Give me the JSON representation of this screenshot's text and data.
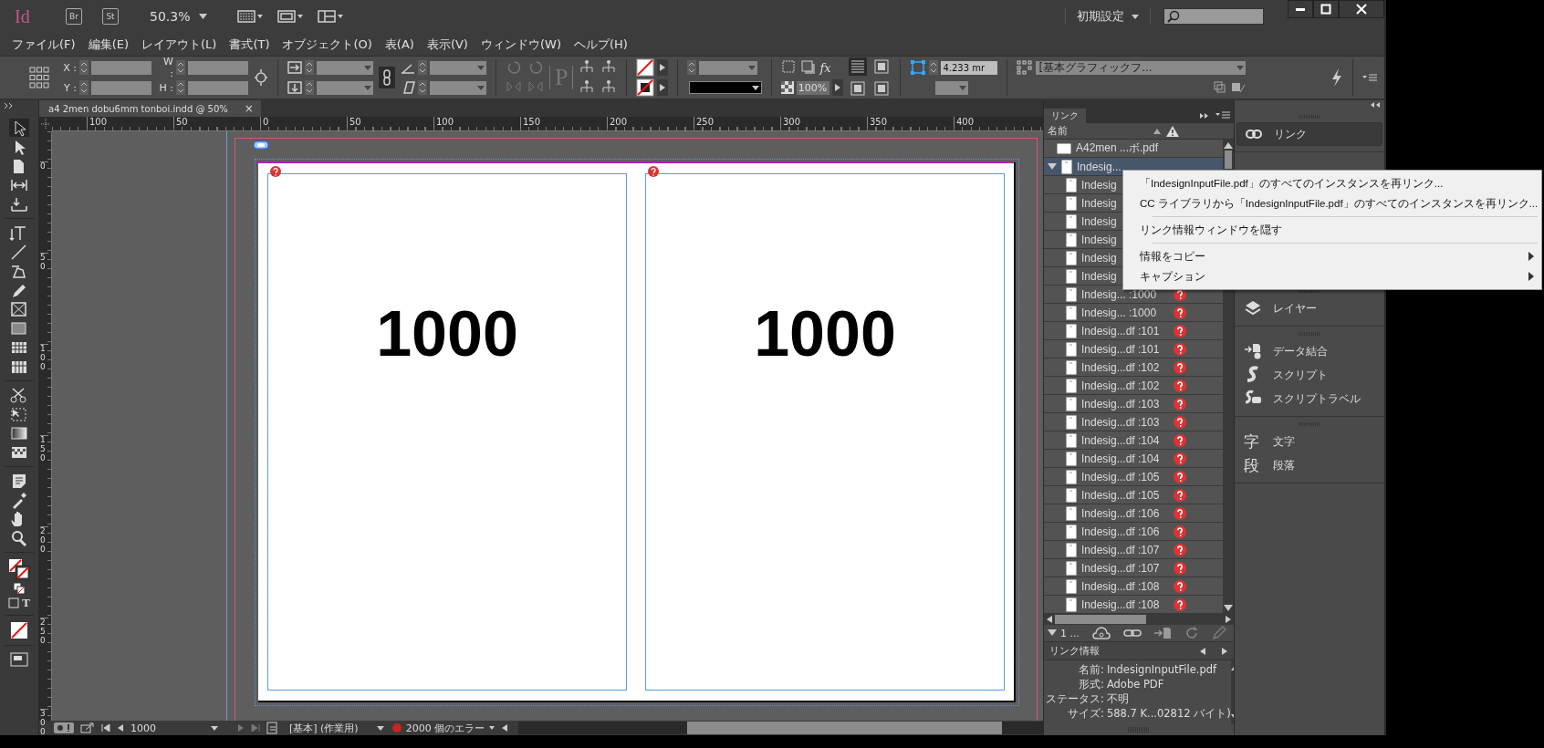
{
  "app": {
    "logo": "Id",
    "bridge": "Br",
    "stock": "St",
    "zoom": "50.3%",
    "workspace": "初期設定"
  },
  "menu": [
    "ファイル(F)",
    "編集(E)",
    "レイアウト(L)",
    "書式(T)",
    "オブジェクト(O)",
    "表(A)",
    "表示(V)",
    "ウィンドウ(W)",
    "ヘルプ(H)"
  ],
  "control_panel": {
    "x_label": "X :",
    "y_label": "Y :",
    "w_label": "W :",
    "h_label": "H :",
    "p_glyph": "P",
    "fx_label": "fx",
    "opacity": "100%",
    "corner_size": "4.233 mr",
    "object_style": "[基本グラフィックフ..."
  },
  "document_tab": {
    "title": "a4 2men dobu6mm tonboi.indd @ 50%",
    "close": "×"
  },
  "ruler_h": [
    "100",
    "50",
    "0",
    "50",
    "100",
    "150",
    "200",
    "250",
    "300",
    "350",
    "400"
  ],
  "ruler_v": [
    "0",
    "50",
    "100",
    "150",
    "200",
    "250",
    "300"
  ],
  "tools": {
    "text_toggle": "T"
  },
  "pages": [
    {
      "text": "1000"
    },
    {
      "text": "1000"
    }
  ],
  "status_bar": {
    "page": "1000",
    "master": "[基本] (作業用)",
    "errors": "2000 個のエラー"
  },
  "links_panel": {
    "tab": "リンク",
    "column": "名前",
    "items": [
      {
        "name": "A42men ...ボ.pdf",
        "selected": false,
        "missing": false
      },
      {
        "name": "Indesig...",
        "selected": true,
        "expanded": true,
        "children": [
          {
            "name": "Indesig"
          },
          {
            "name": "Indesig"
          },
          {
            "name": "Indesig"
          },
          {
            "name": "Indesig"
          },
          {
            "name": "Indesig"
          },
          {
            "name": "Indesig"
          },
          {
            "name": "Indesig... :1000",
            "missing": true
          },
          {
            "name": "Indesig... :1000",
            "missing": true
          },
          {
            "name": "Indesig...df :101",
            "missing": true
          },
          {
            "name": "Indesig...df :101",
            "missing": true
          },
          {
            "name": "Indesig...df :102",
            "missing": true
          },
          {
            "name": "Indesig...df :102",
            "missing": true
          },
          {
            "name": "Indesig...df :103",
            "missing": true
          },
          {
            "name": "Indesig...df :103",
            "missing": true
          },
          {
            "name": "Indesig...df :104",
            "missing": true
          },
          {
            "name": "Indesig...df :104",
            "missing": true
          },
          {
            "name": "Indesig...df :105",
            "missing": true
          },
          {
            "name": "Indesig...df :105",
            "missing": true
          },
          {
            "name": "Indesig...df :106",
            "missing": true
          },
          {
            "name": "Indesig...df :106",
            "missing": true
          },
          {
            "name": "Indesig...df :107",
            "missing": true
          },
          {
            "name": "Indesig...df :107",
            "missing": true
          },
          {
            "name": "Indesig...df :108",
            "missing": true
          },
          {
            "name": "Indesig...df :108",
            "missing": true
          }
        ]
      }
    ],
    "footer_count": "1 ...",
    "info_title": "リンク情報",
    "info": [
      {
        "label": "名前:",
        "value": "IndesignInputFile.pdf"
      },
      {
        "label": "形式:",
        "value": "Adobe PDF"
      },
      {
        "label": "ステータス:",
        "value": "不明"
      },
      {
        "label": "サイズ:",
        "value": "588.7  K...02812 バイト)"
      }
    ]
  },
  "dock": {
    "groups": [
      [
        {
          "label": "リンク",
          "kind": "links",
          "selected": true
        }
      ],
      [
        {
          "label": "レイヤー",
          "kind": "layers",
          "selected": false
        }
      ],
      [
        {
          "label": "データ結合",
          "kind": "data-merge",
          "selected": false
        },
        {
          "label": "スクリプト",
          "kind": "scripts",
          "selected": false
        },
        {
          "label": "スクリプトラベル",
          "kind": "script-label",
          "selected": false
        }
      ],
      [
        {
          "label": "文字",
          "kind": "glyph",
          "icon_text": "字",
          "selected": false
        },
        {
          "label": "段落",
          "kind": "glyph",
          "icon_text": "段",
          "selected": false
        }
      ]
    ]
  },
  "context_menu": {
    "groups": [
      [
        {
          "label": "「IndesignInputFile.pdf」のすべてのインスタンスを再リンク...",
          "submenu": false
        },
        {
          "label": "CC ライブラリから「IndesignInputFile.pdf」のすべてのインスタンスを再リンク...",
          "submenu": false
        }
      ],
      [
        {
          "label": "リンク情報ウィンドウを隠す",
          "submenu": false
        }
      ],
      [
        {
          "label": "情報をコピー",
          "submenu": true
        },
        {
          "label": "キャプション",
          "submenu": true
        }
      ]
    ]
  }
}
